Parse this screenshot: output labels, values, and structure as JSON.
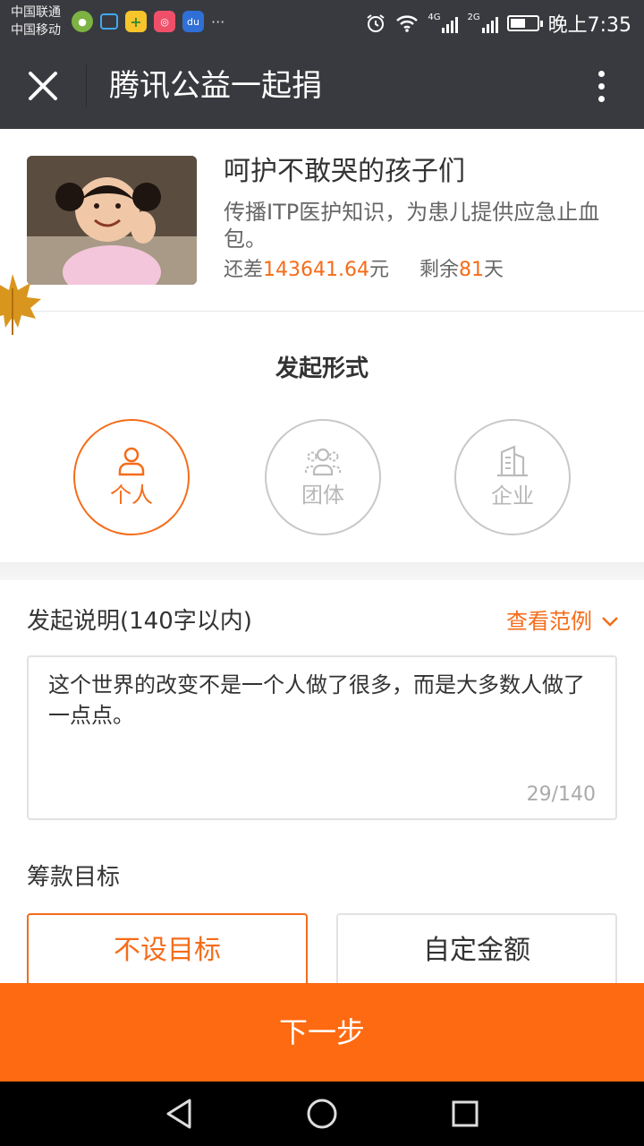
{
  "status_bar": {
    "carrier_1": "中国联通",
    "carrier_2": "中国移动",
    "network_1": "4G",
    "network_2": "2G",
    "time": "晚上7:35",
    "notification_icons": [
      "wechat-icon",
      "lock-icon",
      "plus-icon",
      "app-icon",
      "baidu-icon"
    ],
    "more_notifications": "···",
    "battery_fraction": 0.6
  },
  "nav": {
    "title": "腾讯公益一起捐"
  },
  "project": {
    "title": "呵护不敢哭的孩子们",
    "description": "传播ITP医护知识，为患儿提供应急止血包。",
    "remaining_label": "还差",
    "remaining_amount": "143641.64",
    "remaining_unit": "元",
    "days_label": "剩余",
    "days_value": "81",
    "days_unit": "天"
  },
  "form": {
    "heading": "发起形式",
    "options": [
      {
        "label": "个人",
        "icon": "person-icon",
        "selected": true
      },
      {
        "label": "团体",
        "icon": "group-icon",
        "selected": false
      },
      {
        "label": "企业",
        "icon": "building-icon",
        "selected": false
      }
    ]
  },
  "description": {
    "label": "发起说明(140字以内)",
    "example_link": "查看范例",
    "text": "这个世界的改变不是一个人做了很多，而是大多数人做了一点点。",
    "char_count": "29/140"
  },
  "goal": {
    "label": "筹款目标",
    "options": [
      {
        "label": "不设目标",
        "selected": true
      },
      {
        "label": "自定金额",
        "selected": false
      }
    ]
  },
  "next_button": "下一步",
  "colors": {
    "accent": "#f56c1a",
    "next_button_bg": "#fe6a11",
    "header_bg": "#393a3f"
  }
}
